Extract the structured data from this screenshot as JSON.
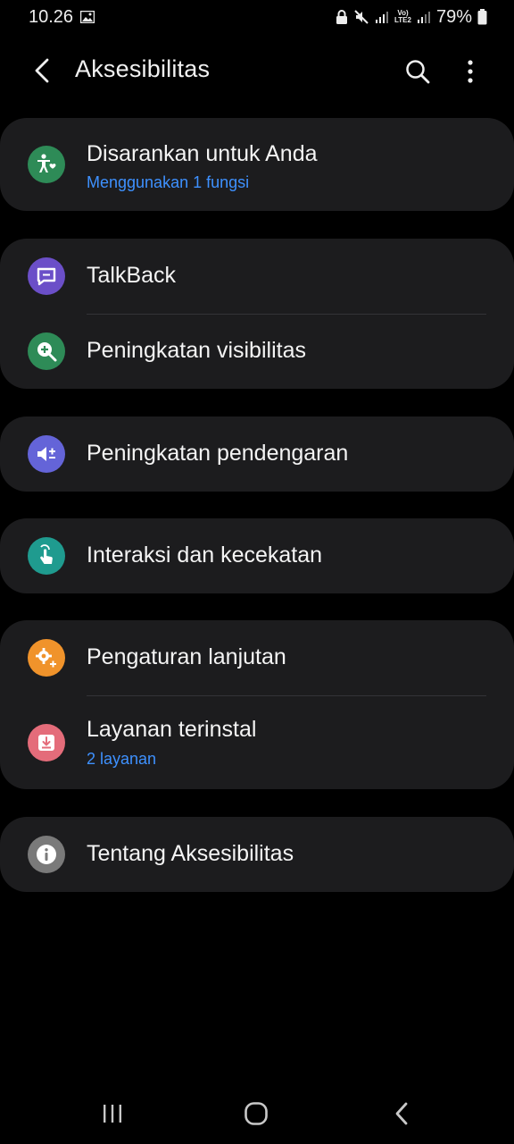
{
  "status_bar": {
    "time": "10.26",
    "battery_percent": "79%",
    "volte_top": "Vo)",
    "volte_bottom": "LTE2"
  },
  "header": {
    "title": "Aksesibilitas",
    "icons": [
      "back-arrow-icon",
      "search-icon",
      "more-vert-icon"
    ]
  },
  "groups": [
    {
      "items": [
        {
          "label": "Disarankan untuk Anda",
          "sub": "Menggunakan 1 fungsi",
          "icon": "accessibility-person-icon",
          "color": "#2e8b57"
        }
      ]
    },
    {
      "items": [
        {
          "label": "TalkBack",
          "icon": "talkback-icon",
          "color": "#6b4fc8"
        },
        {
          "label": "Peningkatan visibilitas",
          "icon": "zoom-in-icon",
          "color": "#2e8b57"
        }
      ]
    },
    {
      "items": [
        {
          "label": "Peningkatan pendengaran",
          "icon": "hearing-icon",
          "color": "#6464d8"
        }
      ]
    },
    {
      "items": [
        {
          "label": "Interaksi dan kecekatan",
          "icon": "touch-hand-icon",
          "color": "#1f9b8f"
        }
      ]
    },
    {
      "items": [
        {
          "label": "Pengaturan lanjutan",
          "icon": "advanced-gear-icon",
          "color": "#f0932b"
        },
        {
          "label": "Layanan terinstal",
          "sub": "2 layanan",
          "icon": "installed-services-icon",
          "color": "#e46c7a"
        }
      ]
    },
    {
      "items": [
        {
          "label": "Tentang Aksesibilitas",
          "icon": "info-icon",
          "color": "#7a7a7a"
        }
      ]
    }
  ],
  "nav_bar": {
    "icons": [
      "recent-apps-icon",
      "home-icon",
      "back-icon"
    ]
  }
}
